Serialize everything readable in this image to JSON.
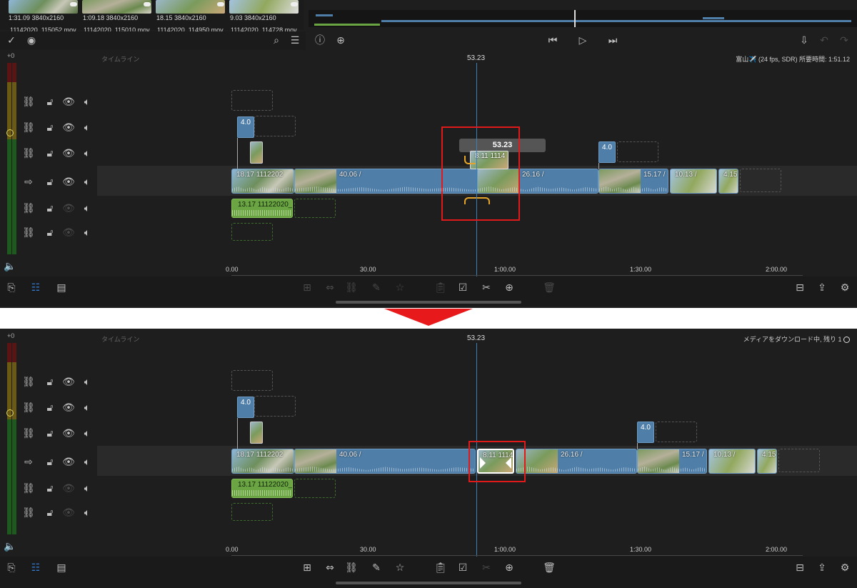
{
  "browser": {
    "clips": [
      {
        "duration": "1:31.09",
        "resolution": "3840x2160",
        "name": "11142020_115052.mov"
      },
      {
        "duration": "1:09.18",
        "resolution": "3840x2160",
        "name": "11142020_115010.mov"
      },
      {
        "duration": "18.15",
        "resolution": "3840x2160",
        "name": "11142020_114950.mov"
      },
      {
        "duration": "9.03",
        "resolution": "3840x2160",
        "name": "11142020_114728.mov"
      }
    ]
  },
  "top": {
    "meter_top_label": "+0",
    "timeline_label": "タイムライン",
    "playhead_time": "53.23",
    "project_info": "富山✈️ (24 fps, SDR)  所要時間: 1:51.12",
    "drag_tooltip": "53.23",
    "ruler": [
      "0.00",
      "30.00",
      "1:00.00",
      "1:30.00",
      "2:00.00"
    ],
    "clips": {
      "first": "18.17  1112202",
      "second": "40.06  /",
      "drag_ghost": "8.11  1114",
      "third": "26.16  /",
      "fourth": "15.17  /",
      "fifth": "10.13  /",
      "sixth": "4.15"
    },
    "title_chip": "4.0",
    "title_chip_right": "4.0",
    "audio_clip": "13.17  11122020_1"
  },
  "bottom": {
    "meter_top_label": "+0",
    "timeline_label": "タイムライン",
    "playhead_time": "53.23",
    "status_text": "メディアをダウンロード中, 残り 1",
    "ruler": [
      "0.00",
      "30.00",
      "1:00.00",
      "1:30.00",
      "2:00.00"
    ],
    "clips": {
      "first": "18.17  1112202",
      "second": "40.06  /",
      "inserted": "8.11  1114",
      "third": "26.16  /",
      "fourth": "15.17  /",
      "fifth": "10.13  /",
      "sixth": "4.15"
    },
    "title_chip": "4.0",
    "title_chip_right": "4.0",
    "audio_clip": "13.17  11122020_1"
  },
  "colors": {
    "highlight": "#e0191b",
    "playhead": "#3b7fb4",
    "video_clip": "#4f7fa8",
    "audio_clip": "#6aa443",
    "trim_bracket": "#e6a52a"
  },
  "icons": {
    "track_link": "link-icon",
    "track_lock": "lock-icon",
    "track_visible": "eye-icon",
    "track_audio": "speaker-icon"
  }
}
